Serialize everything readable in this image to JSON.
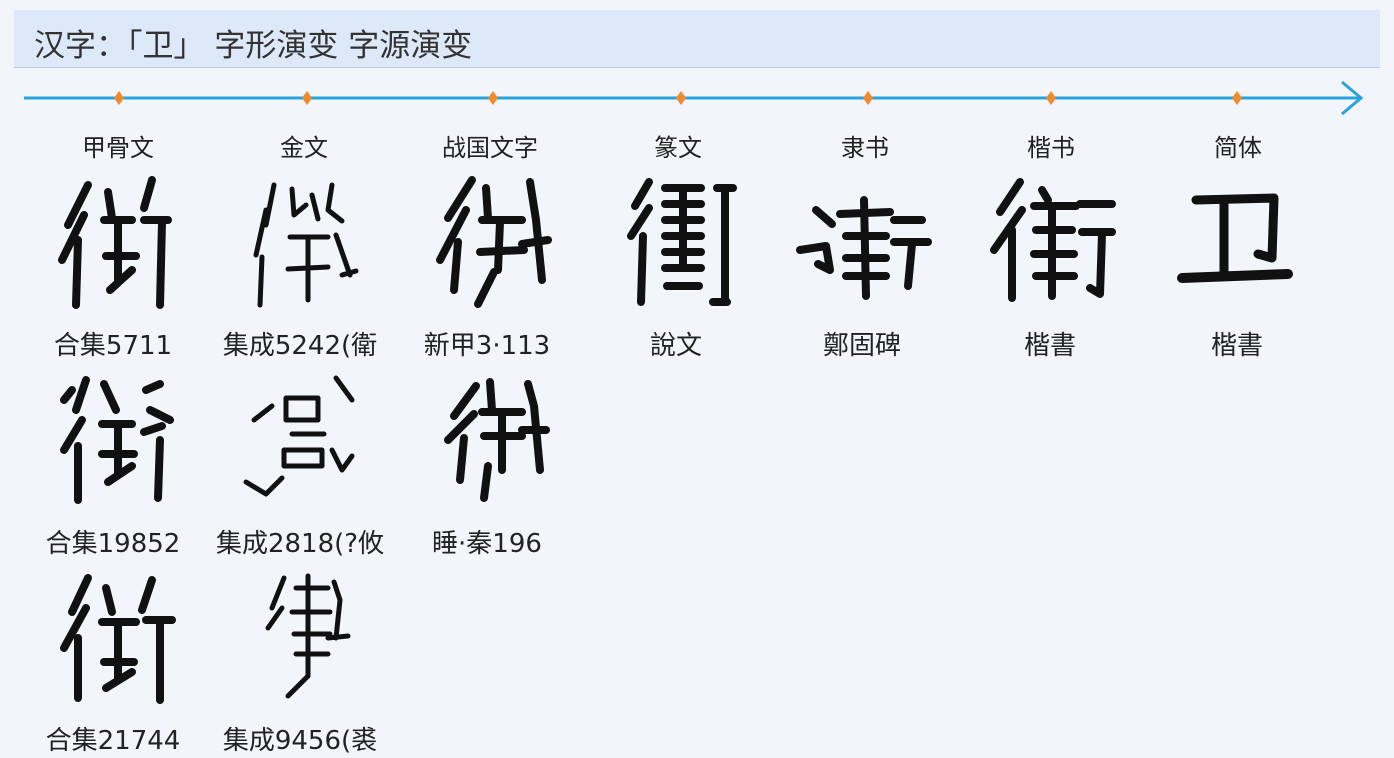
{
  "title": "汉字：「卫」 字形演变 字源演变",
  "colors": {
    "accent": "#2aa3dc",
    "marker": "#f08a2c",
    "header_bg": "#dde9f8"
  },
  "stages": [
    {
      "label": "甲骨文"
    },
    {
      "label": "金文"
    },
    {
      "label": "战国文字"
    },
    {
      "label": "篆文"
    },
    {
      "label": "隶书"
    },
    {
      "label": "楷书"
    },
    {
      "label": "简体"
    }
  ],
  "entries": {
    "r1c1": "合集5711",
    "r1c2": "集成5242(衛",
    "r1c3": "新甲3·113",
    "r1c4": "說文",
    "r1c5": "鄭固碑",
    "r1c6": "楷書",
    "r1c7": "楷書",
    "r2c1": "合集19852",
    "r2c2": "集成2818(?攸",
    "r2c3": "睡·秦196",
    "r3c1": "合集21744",
    "r3c2": "集成9456(裘"
  }
}
